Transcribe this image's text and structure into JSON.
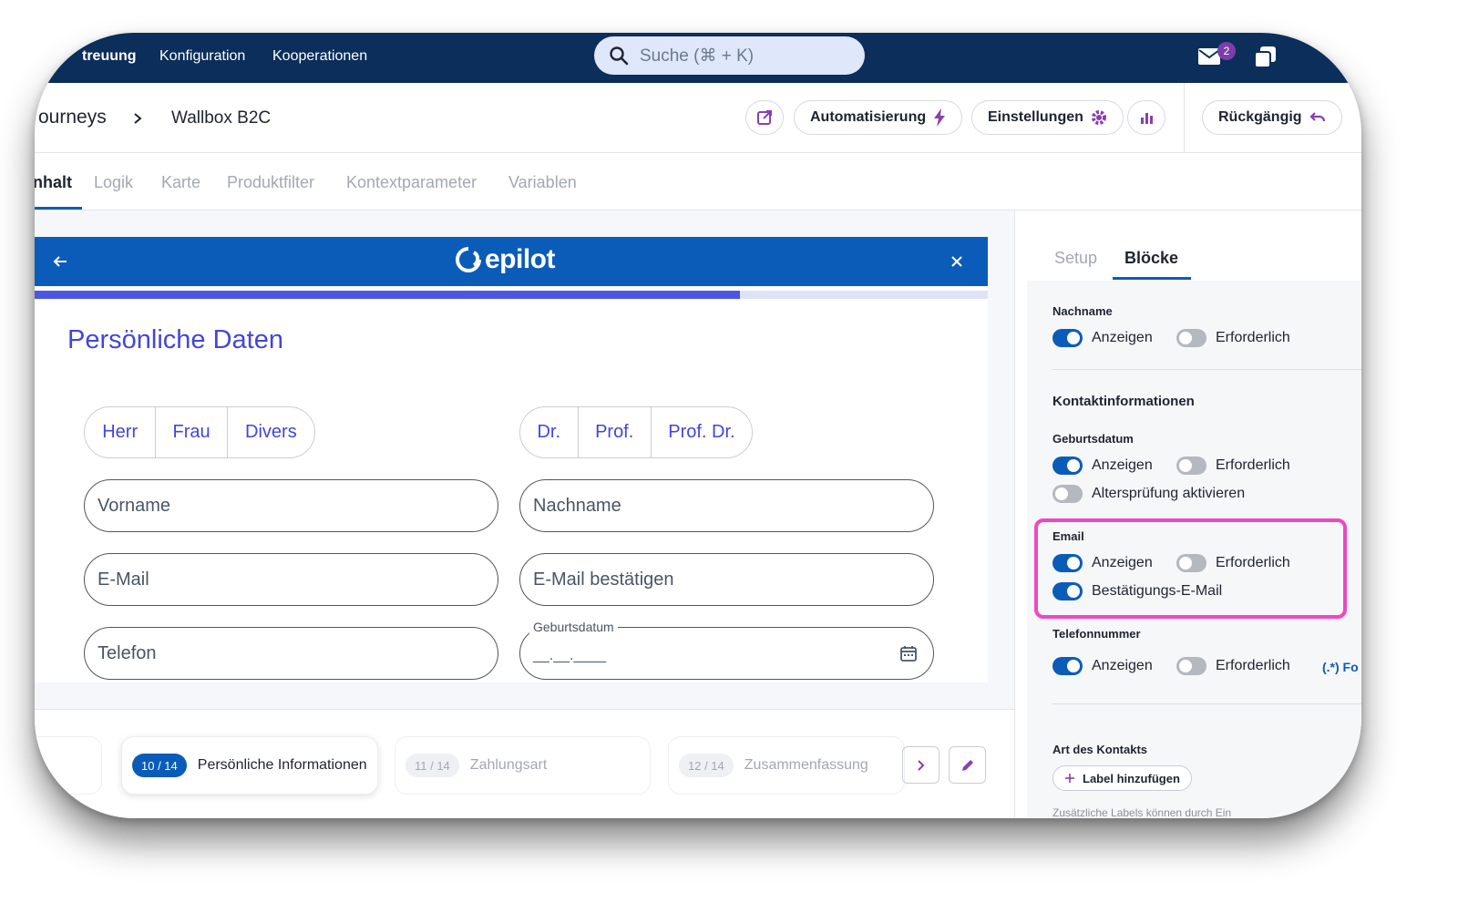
{
  "topbar": {
    "nav": [
      "treuung",
      "Konfiguration",
      "Kooperationen"
    ],
    "search_placeholder": "Suche (⌘ + K)",
    "mail_badge": "2"
  },
  "header": {
    "breadcrumb_parent": "ourneys",
    "breadcrumb_current": "Wallbox B2C",
    "automation_label": "Automatisierung",
    "settings_label": "Einstellungen",
    "undo_label": "Rückgängig"
  },
  "tabs": [
    "nhalt",
    "Logik",
    "Karte",
    "Produktfilter",
    "Kontextparameter",
    "Variablen"
  ],
  "preview": {
    "logo_text": "epilot",
    "progress_percent": 74,
    "title": "Persönliche Daten",
    "salutation": [
      "Herr",
      "Frau",
      "Divers"
    ],
    "academic_title": [
      "Dr.",
      "Prof.",
      "Prof. Dr."
    ],
    "fields": {
      "vorname": "Vorname",
      "nachname": "Nachname",
      "email": "E-Mail",
      "email_confirm": "E-Mail bestätigen",
      "telefon": "Telefon",
      "geburtsdatum_label": "Geburtsdatum",
      "geburtsdatum_value": "__.__.____"
    }
  },
  "steps": [
    {
      "counter": "10 / 14",
      "label": "Persönliche Informationen"
    },
    {
      "counter": "11 / 14",
      "label": "Zahlungsart"
    },
    {
      "counter": "12 / 14",
      "label": "Zusammenfassung"
    }
  ],
  "panel": {
    "tabs": [
      "Setup",
      "Blöcke"
    ],
    "nachname_label": "Nachname",
    "anzeigen": "Anzeigen",
    "erforderlich": "Erforderlich",
    "kontakt_heading": "Kontaktinformationen",
    "geburtsdatum_label": "Geburtsdatum",
    "alterspruefung": "Altersprüfung aktivieren",
    "email_label": "Email",
    "bestaetigung": "Bestätigungs-E-Mail",
    "telefon_label": "Telefonnummer",
    "format_link": "(.*) Fo",
    "art_label": "Art des Kontakts",
    "label_btn": "Label hinzufügen",
    "hint": "Zusätzliche Labels können durch Ein"
  },
  "colors": {
    "topbar": "#0b2e5b",
    "brand": "#0b5cb8",
    "accent": "#4346d8",
    "highlight": "#f046c4"
  }
}
